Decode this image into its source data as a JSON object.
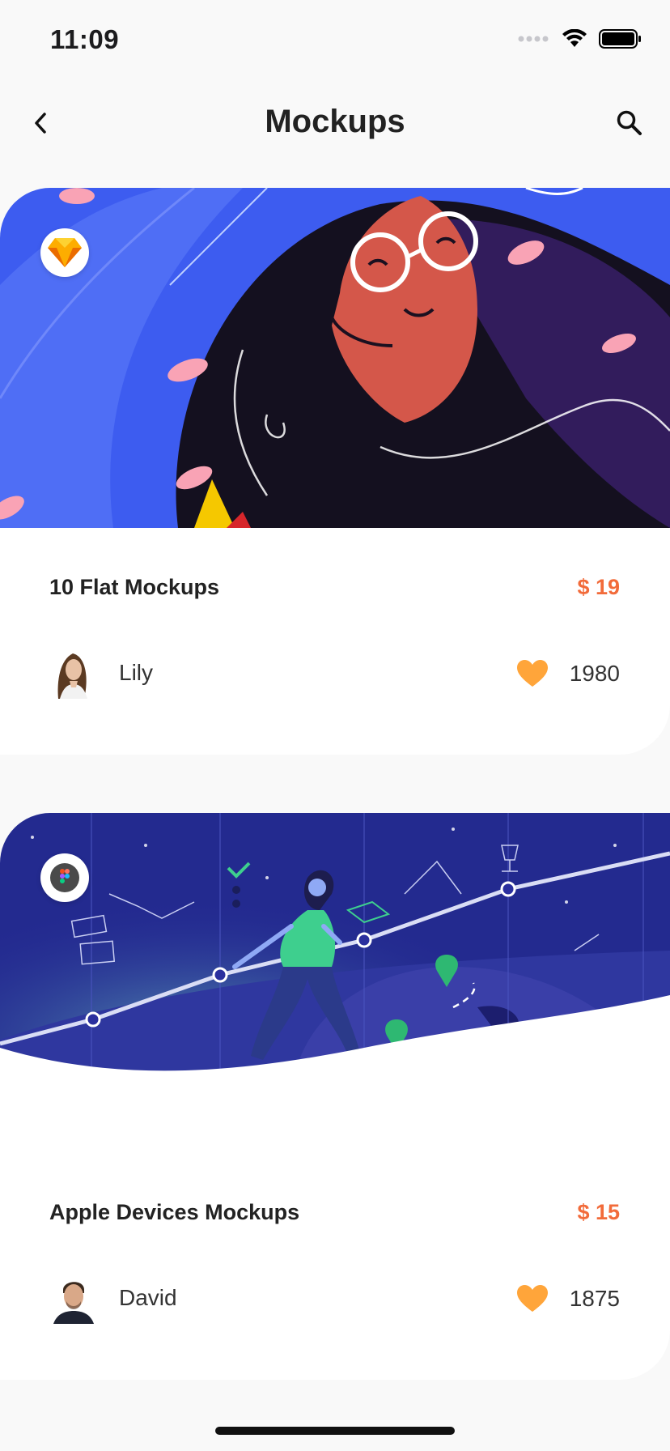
{
  "status_bar": {
    "time": "11:09"
  },
  "nav": {
    "title": "Mockups"
  },
  "cards": [
    {
      "title": "10 Flat Mockups",
      "price": "$ 19",
      "app": "sketch-icon",
      "author": "Lily",
      "likes": "1980"
    },
    {
      "title": "Apple Devices Mockups",
      "price": "$ 15",
      "app": "figma-icon",
      "author": "David",
      "likes": "1875"
    }
  ],
  "colors": {
    "accent_price": "#F26B3A",
    "heart": "#FFA53A",
    "background": "#F9F9F9",
    "hero_blue": "#3D5CF0",
    "hero_navy": "#2A2F9E"
  }
}
